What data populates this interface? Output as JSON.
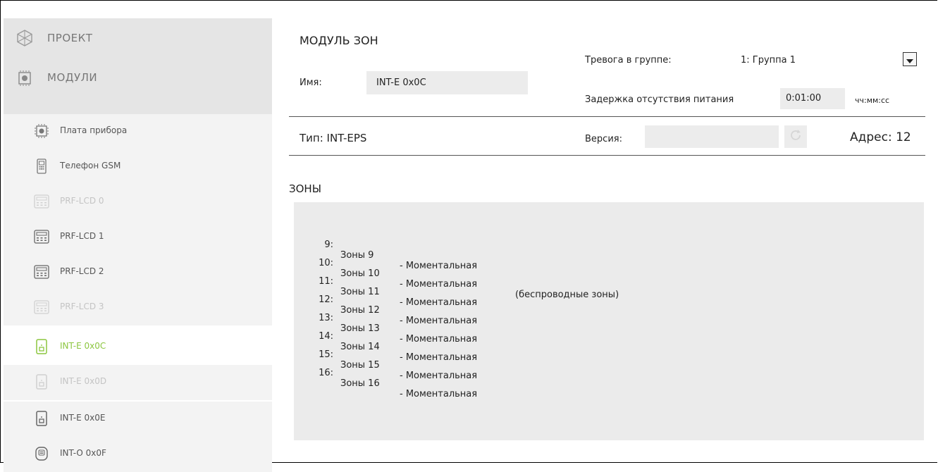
{
  "sidebar": {
    "top_items": [
      {
        "label": "ПРОЕКТ",
        "icon": "project-icon"
      },
      {
        "label": "МОДУЛИ",
        "icon": "modules-icon"
      }
    ],
    "items": [
      {
        "label": "Плата прибора",
        "icon": "chip-icon",
        "state": "normal"
      },
      {
        "label": "Телефон GSM",
        "icon": "phone-icon",
        "state": "normal"
      },
      {
        "label": "PRF-LCD 0",
        "icon": "keypad-icon",
        "state": "disabled"
      },
      {
        "label": "PRF-LCD 1",
        "icon": "keypad-icon",
        "state": "normal"
      },
      {
        "label": "PRF-LCD 2",
        "icon": "keypad-icon",
        "state": "normal"
      },
      {
        "label": "PRF-LCD 3",
        "icon": "keypad-icon",
        "state": "disabled"
      },
      {
        "label": "INT-E 0x0C",
        "icon": "expander-icon",
        "state": "active"
      },
      {
        "label": "INT-E 0x0D",
        "icon": "expander-icon",
        "state": "disabled"
      },
      {
        "label": "INT-E 0x0E",
        "icon": "expander-icon",
        "state": "normal"
      },
      {
        "label": "INT-O 0x0F",
        "icon": "output-module-icon",
        "state": "normal"
      }
    ]
  },
  "module": {
    "title": "МОДУЛЬ ЗОН",
    "name_label": "Имя:",
    "name_value": "INT-E 0x0C",
    "alarm_label": "Тревога в группе:",
    "alarm_value": "1: Группа 1",
    "delay_label": "Задержка отсутствия питания",
    "delay_value": "0:01:00",
    "delay_unit": "чч:мм:сс",
    "type_text": "Тип:  INT-EPS",
    "version_label": "Версия:",
    "version_value": "",
    "address_text": "Адрес: 12"
  },
  "zones": {
    "title": "ЗОНЫ",
    "rows": [
      {
        "num": "9:",
        "name": "Зоны 9",
        "type": "- Моментальная",
        "note": ""
      },
      {
        "num": "10:",
        "name": "Зоны 10",
        "type": "- Моментальная",
        "note": "(беспроводные зоны)"
      },
      {
        "num": "11:",
        "name": "Зоны 11",
        "type": "- Моментальная",
        "note": ""
      },
      {
        "num": "12:",
        "name": "Зоны 12",
        "type": "- Моментальная",
        "note": ""
      },
      {
        "num": "13:",
        "name": "Зоны 13",
        "type": "- Моментальная",
        "note": ""
      },
      {
        "num": "14:",
        "name": "Зоны 14",
        "type": "- Моментальная",
        "note": ""
      },
      {
        "num": "15:",
        "name": "Зоны 15",
        "type": "- Моментальная",
        "note": ""
      },
      {
        "num": "16:",
        "name": "Зоны 16",
        "type": "- Моментальная",
        "note": ""
      }
    ]
  },
  "colors": {
    "active": "#8cc63f",
    "disabled": "#c4c4c4",
    "panel_bg": "#ebebeb",
    "sidebar_bg": "#f3f3f3"
  }
}
